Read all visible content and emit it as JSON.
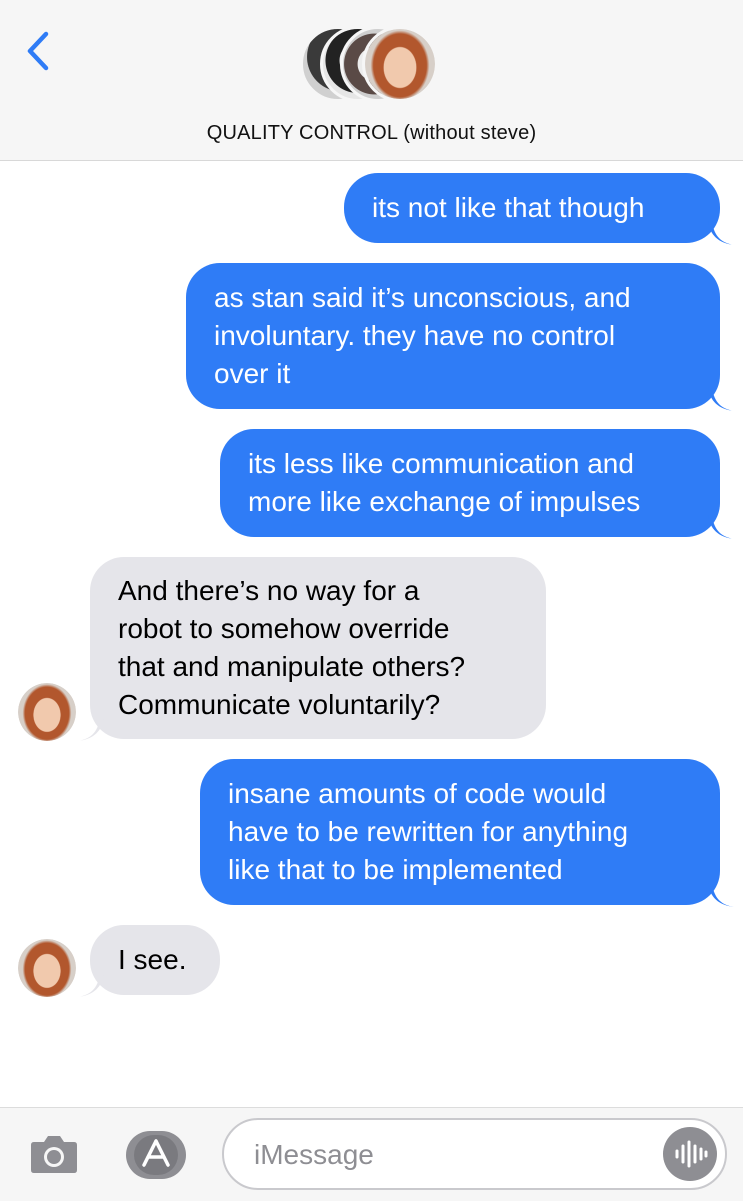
{
  "header": {
    "title": "QUALITY CONTROL (without steve)",
    "back_icon": "chevron-left-icon",
    "accent_color": "#2f7cf6"
  },
  "messages": [
    {
      "direction": "outgoing",
      "lines": [
        "its not like that though"
      ]
    },
    {
      "direction": "outgoing",
      "lines": [
        "as stan said it’s unconscious, and",
        "involuntary. they have no control",
        "over it"
      ]
    },
    {
      "direction": "outgoing",
      "lines": [
        "its less like communication and",
        "more like exchange of impulses"
      ]
    },
    {
      "direction": "incoming",
      "lines": [
        "And there’s no way for a",
        "robot to somehow override",
        "that and manipulate others?",
        "Communicate voluntarily?"
      ]
    },
    {
      "direction": "outgoing",
      "lines": [
        "insane amounts of code would",
        "have to be rewritten for anything",
        "like that to be implemented"
      ]
    },
    {
      "direction": "incoming",
      "lines": [
        "I see."
      ]
    }
  ],
  "colors": {
    "outgoing_bubble": "#2f7cf6",
    "incoming_bubble": "#e5e5ea"
  },
  "input_bar": {
    "placeholder": "iMessage",
    "camera_icon": "camera-icon",
    "apps_icon": "app-store-icon",
    "audio_icon": "audio-waveform-icon"
  }
}
